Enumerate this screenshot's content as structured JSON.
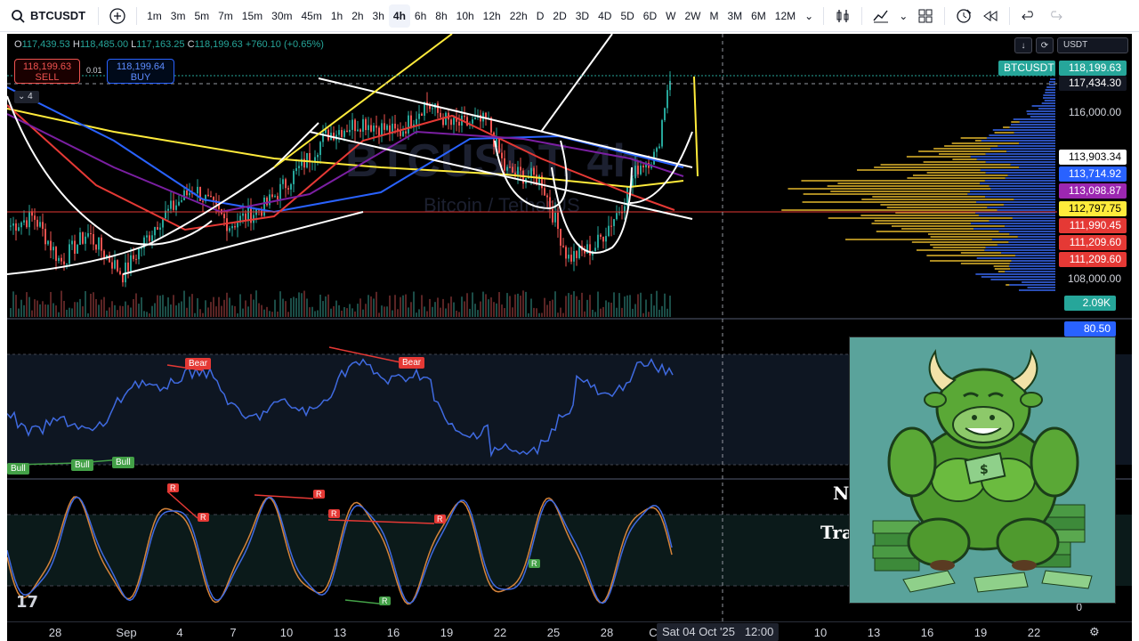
{
  "toolbar": {
    "symbol": "BTCUSDT",
    "add_symbol": "+",
    "intervals": [
      "1m",
      "3m",
      "5m",
      "7m",
      "15m",
      "30m",
      "45m",
      "1h",
      "2h",
      "3h",
      "4h",
      "6h",
      "8h",
      "10h",
      "12h",
      "22h",
      "D",
      "2D",
      "3D",
      "4D",
      "5D",
      "6D",
      "W",
      "2W",
      "M",
      "3M",
      "6M",
      "12M"
    ],
    "active_interval": "4h",
    "more": "⌄"
  },
  "legend": {
    "open_label": "O",
    "open": "117,439.53",
    "high_label": "H",
    "high": "118,485.00",
    "low_label": "L",
    "low": "117,163.25",
    "close_label": "C",
    "close": "118,199.63",
    "change": "+760.10 (+0.65%)",
    "sell_price": "118,199.63",
    "sell_label": "SELL",
    "buy_price": "118,199.64",
    "buy_label": "BUY",
    "spread": "0.01",
    "indicator_count": "4"
  },
  "currency": "USDT",
  "watermark": {
    "symbol": "BTCUSDT, 4h",
    "name": "Bitcoin / TetherUS"
  },
  "price_scale": {
    "symbol_tag": "BTCUSDT",
    "last_price": "118,199.63",
    "crosshair_price": "117,434.30",
    "level_116": "116,000.00",
    "level_108": "108,000.00",
    "tags": [
      {
        "value": "113,903.34",
        "color": "#ffffff",
        "text_color": "#000000"
      },
      {
        "value": "113,714.92",
        "color": "#2962ff",
        "text_color": "#ffffff"
      },
      {
        "value": "113,098.87",
        "color": "#9c27b0",
        "text_color": "#ffffff"
      },
      {
        "value": "112,797.75",
        "color": "#ffeb3b",
        "text_color": "#000000"
      },
      {
        "value": "111,990.45",
        "color": "#e53935",
        "text_color": "#ffffff"
      },
      {
        "value": "111,209.60",
        "color": "#e53935",
        "text_color": "#ffffff"
      },
      {
        "value": "111,209.60",
        "color": "#e53935",
        "text_color": "#ffffff"
      }
    ],
    "volume": "2.09K",
    "rsi_value": "80.50",
    "osc_zero": "0"
  },
  "rsi_labels": {
    "bear1": "Bear",
    "bear2": "Bear",
    "bull1": "Bull",
    "bull2": "Bull",
    "bull3": "Bull"
  },
  "osc_labels": {
    "r": "R",
    "g": "R"
  },
  "overlay_text": {
    "line1": "N",
    "line2": "Tra"
  },
  "time_axis": {
    "labels": [
      "28",
      "Sep",
      "4",
      "7",
      "10",
      "13",
      "16",
      "19",
      "22",
      "25",
      "28",
      "C",
      "10",
      "13",
      "16",
      "19",
      "22"
    ],
    "crosshair_date": "Sat 04 Oct '25",
    "crosshair_time": "12:00"
  },
  "colors": {
    "bull": "#26a69a",
    "bear": "#ef5350",
    "ma_yellow": "#ffeb3b",
    "ma_blue": "#2962ff",
    "ma_red": "#e53935",
    "ma_purple": "#7b1fa2",
    "rsi": "#3f6ae0"
  }
}
